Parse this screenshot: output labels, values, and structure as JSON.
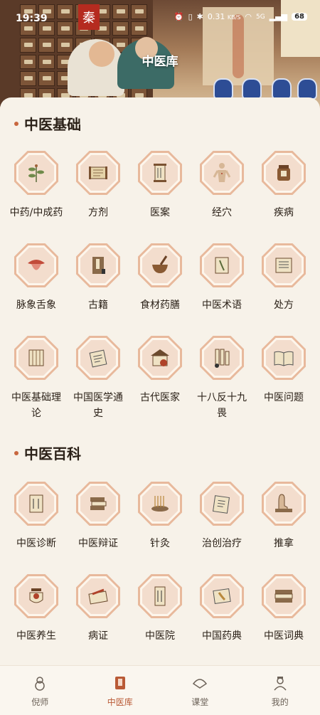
{
  "status_bar": {
    "time": "19:39",
    "net_speed": "0.31",
    "net_unit": "KB/S",
    "network": "5G",
    "battery": "68"
  },
  "header": {
    "title": "中医库",
    "seal_char": "秦"
  },
  "sections": [
    {
      "title": "中医基础",
      "items": [
        {
          "label": "中药/中成药",
          "icon": "herb-sprig-icon"
        },
        {
          "label": "方剂",
          "icon": "scroll-icon"
        },
        {
          "label": "医案",
          "icon": "hanging-scroll-icon"
        },
        {
          "label": "经穴",
          "icon": "acupoint-figure-icon"
        },
        {
          "label": "疾病",
          "icon": "medicine-jar-icon"
        },
        {
          "label": "脉象舌象",
          "icon": "tongue-icon"
        },
        {
          "label": "古籍",
          "icon": "ancient-book-icon"
        },
        {
          "label": "食材药膳",
          "icon": "mortar-bowl-icon"
        },
        {
          "label": "中医术语",
          "icon": "book-with-herb-icon"
        },
        {
          "label": "处方",
          "icon": "prescription-scroll-icon"
        },
        {
          "label": "中医基础理论",
          "icon": "bamboo-book-icon"
        },
        {
          "label": "中国医学通史",
          "icon": "history-book-icon"
        },
        {
          "label": "古代医家",
          "icon": "ancient-house-icon"
        },
        {
          "label": "十八反十九畏",
          "icon": "scroll-stack-icon"
        },
        {
          "label": "中医问题",
          "icon": "open-book-icon"
        }
      ]
    },
    {
      "title": "中医百科",
      "items": [
        {
          "label": "中医诊断",
          "icon": "diagnosis-book-icon"
        },
        {
          "label": "中医辩证",
          "icon": "stacked-books-icon"
        },
        {
          "label": "针灸",
          "icon": "acupuncture-needles-icon"
        },
        {
          "label": "治创治疗",
          "icon": "treatment-book-icon"
        },
        {
          "label": "推拿",
          "icon": "massage-hand-icon"
        },
        {
          "label": "中医养生",
          "icon": "incense-burner-icon"
        },
        {
          "label": "病证",
          "icon": "medicine-box-icon"
        },
        {
          "label": "中医院",
          "icon": "hospital-plaque-icon"
        },
        {
          "label": "中国药典",
          "icon": "pharmacopoeia-book-icon"
        },
        {
          "label": "中医词典",
          "icon": "dictionary-books-icon"
        }
      ]
    }
  ],
  "bottom_nav": [
    {
      "label": "倪师",
      "icon": "gourd-icon",
      "active": false
    },
    {
      "label": "中医库",
      "icon": "library-book-icon",
      "active": true
    },
    {
      "label": "课堂",
      "icon": "fan-icon",
      "active": false
    },
    {
      "label": "我的",
      "icon": "scholar-icon",
      "active": false
    }
  ],
  "colors": {
    "accent": "#b95a36",
    "tile_border": "#e8b99c",
    "background": "#f7f2e9"
  }
}
